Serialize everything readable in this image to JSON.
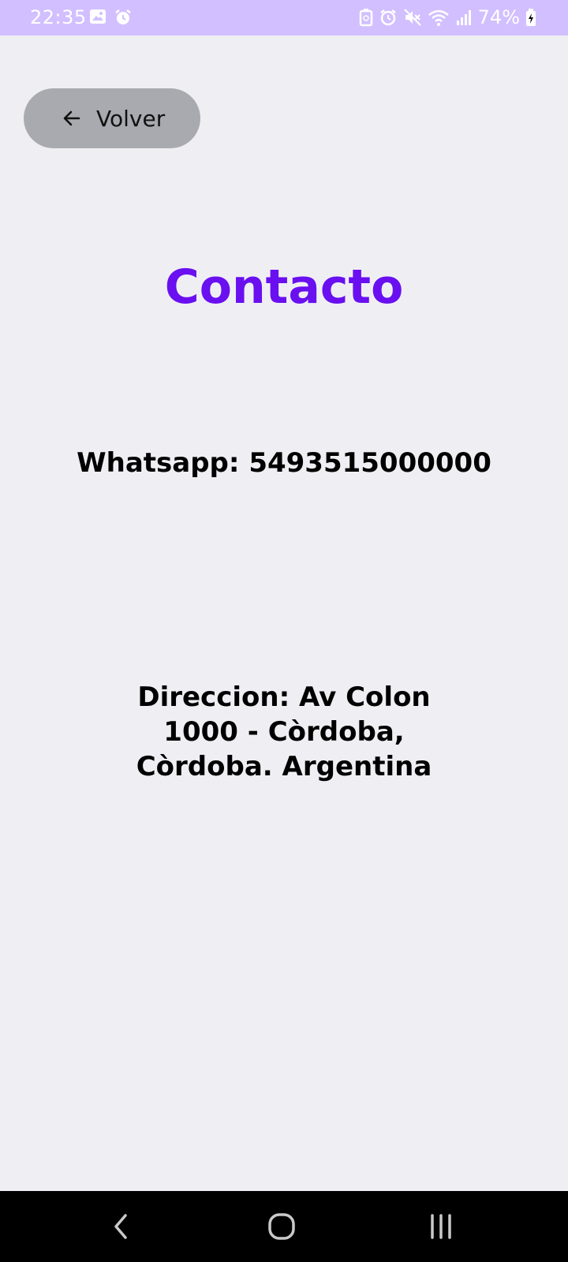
{
  "status_bar": {
    "time": "22:35",
    "battery": "74%",
    "colors": {
      "background": "#d2bfff",
      "foreground": "#ffffff"
    },
    "left_icons": [
      "image-icon",
      "alarm-icon"
    ],
    "right_icons": [
      "battery-saver-icon",
      "alarm-icon",
      "mute-icon",
      "wifi-icon",
      "signal-icon",
      "battery-charging-icon"
    ]
  },
  "back_button": {
    "label": "Volver",
    "icon": "arrow-left-icon"
  },
  "page": {
    "title": "Contacto",
    "whatsapp": "Whatsapp: 5493515000000",
    "address": "Direccion: Av Colon 1000 - Còrdoba, Còrdoba. Argentina"
  },
  "colors": {
    "background": "#efeff3",
    "accent": "#6a0ff0",
    "button": "#a9aaaf"
  },
  "nav_bar": {
    "buttons": [
      "back-nav-icon",
      "home-nav-icon",
      "recents-nav-icon"
    ]
  }
}
